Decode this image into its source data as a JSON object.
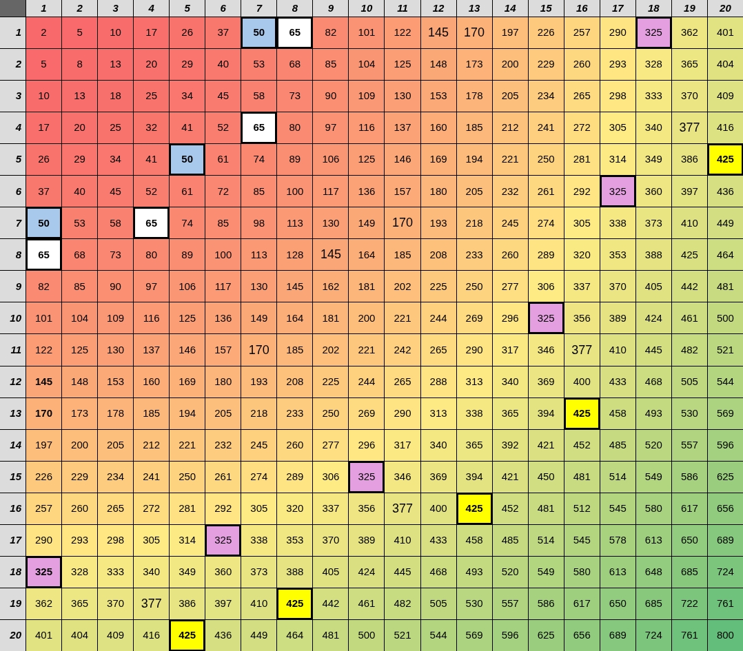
{
  "columns": [
    "1",
    "2",
    "3",
    "4",
    "5",
    "6",
    "7",
    "8",
    "9",
    "10",
    "11",
    "12",
    "13",
    "14",
    "15",
    "16",
    "17",
    "18",
    "19",
    "20"
  ],
  "rows": [
    {
      "header": "1",
      "cells": [
        "2",
        "5",
        "10",
        "17",
        "26",
        "37",
        {
          "text": "50",
          "color": "#a8c8ec",
          "bold": true
        },
        {
          "text": "65",
          "color": "#ffffff",
          "bold": true
        },
        "82",
        "101",
        "122",
        {
          "text": "145",
          "large": true
        },
        {
          "text": "170",
          "large": true
        },
        "197",
        "226",
        "257",
        "290",
        {
          "text": "325",
          "color": "#e49fe0"
        },
        "362",
        "401"
      ]
    },
    {
      "header": "2",
      "cells": [
        "5",
        "8",
        "13",
        "20",
        "29",
        "40",
        "53",
        "68",
        "85",
        "104",
        "125",
        "148",
        "173",
        "200",
        "229",
        "260",
        "293",
        "328",
        "365",
        "404"
      ]
    },
    {
      "header": "3",
      "cells": [
        "10",
        "13",
        "18",
        "25",
        "34",
        "45",
        "58",
        "73",
        "90",
        "109",
        "130",
        "153",
        "178",
        "205",
        "234",
        "265",
        "298",
        "333",
        "370",
        "409"
      ]
    },
    {
      "header": "4",
      "cells": [
        "17",
        "20",
        "25",
        "32",
        "41",
        "52",
        {
          "text": "65",
          "color": "#ffffff",
          "bold": true
        },
        "80",
        "97",
        "116",
        "137",
        "160",
        "185",
        "212",
        "241",
        "272",
        "305",
        "340",
        {
          "text": "377",
          "large": true
        },
        "416"
      ]
    },
    {
      "header": "5",
      "cells": [
        "26",
        "29",
        "34",
        "41",
        {
          "text": "50",
          "color": "#a8c8ec",
          "bold": true
        },
        "61",
        "74",
        "89",
        "106",
        "125",
        "146",
        "169",
        "194",
        "221",
        "250",
        "281",
        "314",
        "349",
        "386",
        {
          "text": "425",
          "color": "#ffff00",
          "bold": true
        }
      ]
    },
    {
      "header": "6",
      "cells": [
        "37",
        "40",
        "45",
        "52",
        "61",
        "72",
        "85",
        "100",
        "117",
        "136",
        "157",
        "180",
        "205",
        "232",
        "261",
        "292",
        {
          "text": "325",
          "color": "#e49fe0"
        },
        "360",
        "397",
        "436"
      ]
    },
    {
      "header": "7",
      "cells": [
        {
          "text": "50",
          "color": "#a8c8ec",
          "bold": true
        },
        "53",
        "58",
        {
          "text": "65",
          "color": "#ffffff",
          "bold": true
        },
        "74",
        "85",
        "98",
        "113",
        "130",
        "149",
        {
          "text": "170",
          "large": true
        },
        "193",
        "218",
        "245",
        "274",
        "305",
        "338",
        "373",
        "410",
        "449"
      ]
    },
    {
      "header": "8",
      "cells": [
        {
          "text": "65",
          "color": "#ffffff",
          "bold": true
        },
        "68",
        "73",
        "80",
        "89",
        "100",
        "113",
        "128",
        {
          "text": "145",
          "large": true
        },
        "164",
        "185",
        "208",
        "233",
        "260",
        "289",
        "320",
        "353",
        "388",
        "425",
        "464"
      ]
    },
    {
      "header": "9",
      "cells": [
        "82",
        "85",
        "90",
        "97",
        "106",
        "117",
        "130",
        "145",
        "162",
        "181",
        "202",
        "225",
        "250",
        "277",
        "306",
        "337",
        "370",
        "405",
        "442",
        "481"
      ]
    },
    {
      "header": "10",
      "cells": [
        "101",
        "104",
        "109",
        "116",
        "125",
        "136",
        "149",
        "164",
        "181",
        "200",
        "221",
        "244",
        "269",
        "296",
        {
          "text": "325",
          "color": "#e49fe0"
        },
        "356",
        "389",
        "424",
        "461",
        "500"
      ]
    },
    {
      "header": "11",
      "cells": [
        "122",
        "125",
        "130",
        "137",
        "146",
        "157",
        {
          "text": "170",
          "large": true
        },
        "185",
        "202",
        "221",
        "242",
        "265",
        "290",
        "317",
        "346",
        {
          "text": "377",
          "large": true
        },
        "410",
        "445",
        "482",
        "521"
      ]
    },
    {
      "header": "12",
      "cells": [
        {
          "text": "145",
          "bold": true
        },
        "148",
        "153",
        "160",
        "169",
        "180",
        "193",
        "208",
        "225",
        "244",
        "265",
        "288",
        "313",
        "340",
        "369",
        "400",
        "433",
        "468",
        "505",
        "544"
      ]
    },
    {
      "header": "13",
      "cells": [
        {
          "text": "170",
          "bold": true
        },
        "173",
        "178",
        "185",
        "194",
        "205",
        "218",
        "233",
        "250",
        "269",
        "290",
        "313",
        "338",
        "365",
        "394",
        {
          "text": "425",
          "color": "#ffff00",
          "bold": true
        },
        "458",
        "493",
        "530",
        "569"
      ]
    },
    {
      "header": "14",
      "cells": [
        "197",
        "200",
        "205",
        "212",
        "221",
        "232",
        "245",
        "260",
        "277",
        "296",
        "317",
        "340",
        "365",
        "392",
        "421",
        "452",
        "485",
        "520",
        "557",
        "596"
      ]
    },
    {
      "header": "15",
      "cells": [
        "226",
        "229",
        "234",
        "241",
        "250",
        "261",
        "274",
        "289",
        "306",
        {
          "text": "325",
          "color": "#e49fe0"
        },
        "346",
        "369",
        "394",
        "421",
        "450",
        "481",
        "514",
        "549",
        "586",
        "625"
      ]
    },
    {
      "header": "16",
      "cells": [
        "257",
        "260",
        "265",
        "272",
        "281",
        "292",
        "305",
        "320",
        "337",
        "356",
        {
          "text": "377",
          "large": true
        },
        "400",
        {
          "text": "425",
          "color": "#ffff00",
          "bold": true
        },
        "452",
        "481",
        "512",
        "545",
        "580",
        "617",
        "656"
      ]
    },
    {
      "header": "17",
      "cells": [
        "290",
        "293",
        "298",
        "305",
        "314",
        {
          "text": "325",
          "color": "#e49fe0"
        },
        "338",
        "353",
        "370",
        "389",
        "410",
        "433",
        "458",
        "485",
        "514",
        "545",
        "578",
        "613",
        "650",
        "689"
      ]
    },
    {
      "header": "18",
      "cells": [
        {
          "text": "325",
          "color": "#e49fe0",
          "bold": true
        },
        "328",
        "333",
        "340",
        "349",
        "360",
        "373",
        "388",
        "405",
        "424",
        "445",
        "468",
        "493",
        "520",
        "549",
        "580",
        "613",
        "648",
        "685",
        "724"
      ]
    },
    {
      "header": "19",
      "cells": [
        "362",
        "365",
        "370",
        {
          "text": "377",
          "large": true
        },
        "386",
        "397",
        "410",
        {
          "text": "425",
          "color": "#ffff00",
          "bold": true
        },
        "442",
        "461",
        "482",
        "505",
        "530",
        "557",
        "586",
        "617",
        "650",
        "685",
        "722",
        "761"
      ]
    },
    {
      "header": "20",
      "cells": [
        "401",
        "404",
        "409",
        "416",
        {
          "text": "425",
          "color": "#ffff00",
          "bold": true
        },
        "436",
        "449",
        "464",
        "481",
        "500",
        "521",
        "544",
        "569",
        "596",
        "625",
        "656",
        "689",
        "724",
        "761",
        "800"
      ]
    }
  ]
}
